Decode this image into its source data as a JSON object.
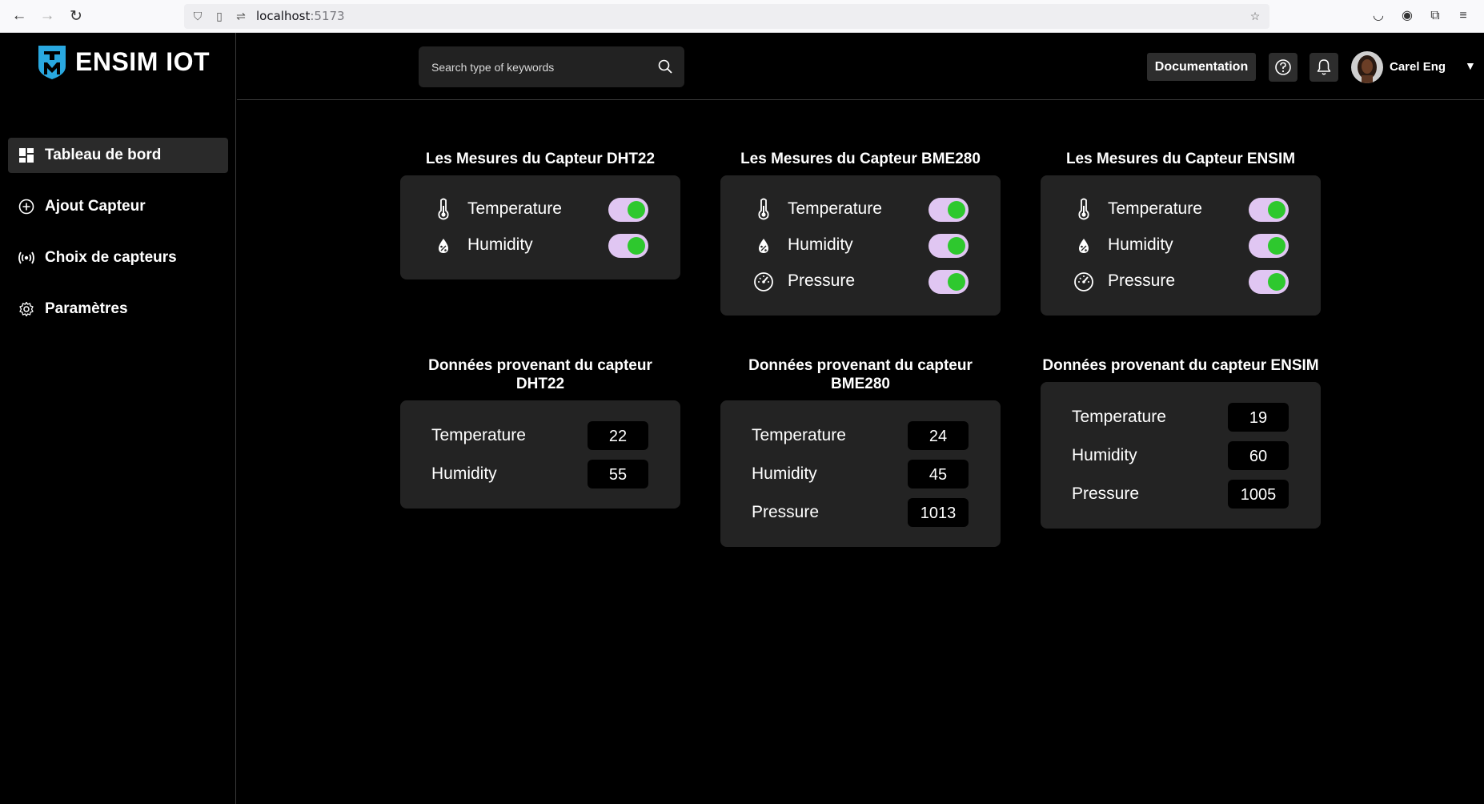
{
  "browser": {
    "url_host": "localhost",
    "url_port": ":5173"
  },
  "app": {
    "brand": "ENSIM IOT"
  },
  "sidebar": {
    "items": [
      {
        "label": "Tableau de bord",
        "icon": "dashboard-icon",
        "active": true
      },
      {
        "label": "Ajout Capteur",
        "icon": "plus-circle-icon",
        "active": false
      },
      {
        "label": "Choix de capteurs",
        "icon": "signal-icon",
        "active": false
      },
      {
        "label": "Paramètres",
        "icon": "gear-icon",
        "active": false
      }
    ]
  },
  "header": {
    "search_placeholder": "Search type of keywords",
    "documentation_label": "Documentation",
    "user_name": "Carel Eng",
    "user_caret": "▼"
  },
  "measures": [
    {
      "title": "Les Mesures du Capteur DHT22",
      "rows": [
        {
          "label": "Temperature",
          "icon": "thermometer-icon",
          "enabled": true
        },
        {
          "label": "Humidity",
          "icon": "humidity-drop-icon",
          "enabled": true
        }
      ]
    },
    {
      "title": "Les Mesures du Capteur BME280",
      "rows": [
        {
          "label": "Temperature",
          "icon": "thermometer-icon",
          "enabled": true
        },
        {
          "label": "Humidity",
          "icon": "humidity-drop-icon",
          "enabled": true
        },
        {
          "label": "Pressure",
          "icon": "gauge-icon",
          "enabled": true
        }
      ]
    },
    {
      "title": "Les Mesures du Capteur ENSIM",
      "rows": [
        {
          "label": "Temperature",
          "icon": "thermometer-icon",
          "enabled": true
        },
        {
          "label": "Humidity",
          "icon": "humidity-drop-icon",
          "enabled": true
        },
        {
          "label": "Pressure",
          "icon": "gauge-icon",
          "enabled": true
        }
      ]
    }
  ],
  "data_cards": [
    {
      "title_line1": "Données provenant du capteur",
      "title_line2": "DHT22",
      "rows": [
        {
          "label": "Temperature",
          "value": "22"
        },
        {
          "label": "Humidity",
          "value": "55"
        }
      ]
    },
    {
      "title_line1": "Données provenant du capteur",
      "title_line2": "BME280",
      "rows": [
        {
          "label": "Temperature",
          "value": "24"
        },
        {
          "label": "Humidity",
          "value": "45"
        },
        {
          "label": "Pressure",
          "value": "1013"
        }
      ]
    },
    {
      "title_line1": "Données provenant du capteur ENSIM",
      "title_line2": "",
      "rows": [
        {
          "label": "Temperature",
          "value": "19"
        },
        {
          "label": "Humidity",
          "value": "60"
        },
        {
          "label": "Pressure",
          "value": "1005"
        }
      ]
    }
  ],
  "colors": {
    "toggle_track": "#e0c6f2",
    "toggle_knob": "#2ec82e",
    "card_bg": "#232323",
    "logo_accent": "#29a8e0"
  }
}
